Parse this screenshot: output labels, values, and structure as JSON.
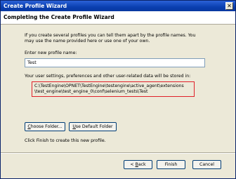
{
  "window": {
    "title": "Create Profile Wizard",
    "close_glyph": "✕"
  },
  "header": {
    "title": "Completing the Create Profile Wizard"
  },
  "intro": {
    "line1": "If you create several profiles you can tell them apart by the profile names. You",
    "line2": "may use the name provided here or use one of your own.",
    "prompt": "Enter new profile name:"
  },
  "profile_name": {
    "value": "Test"
  },
  "storage": {
    "label": "Your user settings, preferences and other user-related data will be stored in:",
    "path_line1": "C:\\TestEngine\\OPNET\\TestEngine\\testengine\\active_agent\\extensions",
    "path_line2": "\\test_engine\\test_engine_0\\conf\\selenium_tests\\Test"
  },
  "folder_buttons": {
    "choose_prefix": "C",
    "choose_rest": "hoose Folder...",
    "default_prefix": "U",
    "default_rest": "se Default Folder"
  },
  "finish_hint": "Click Finish to create this new profile.",
  "nav_buttons": {
    "back_pre": "< ",
    "back_u": "B",
    "back_rest": "ack",
    "finish": "Finish",
    "cancel": "Cancel"
  }
}
